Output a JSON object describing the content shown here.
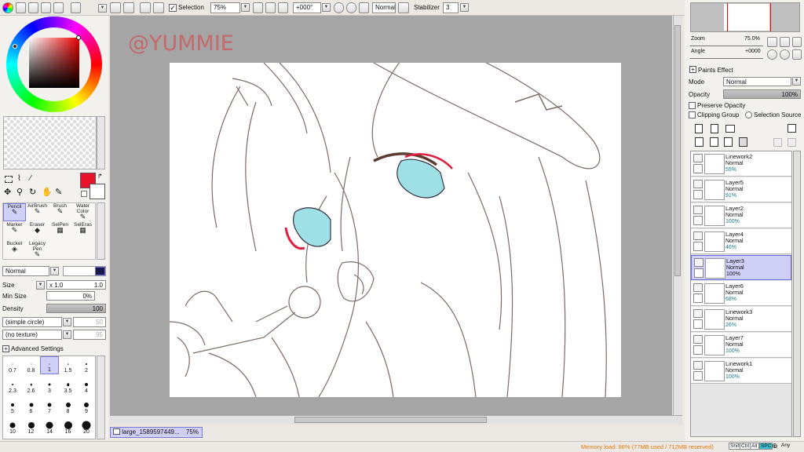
{
  "toolbar": {
    "selection_label": "Selection",
    "zoom": "75%",
    "angle": "+000°",
    "blend": "Normal",
    "stabilizer_label": "Stabilizer",
    "stabilizer": "3"
  },
  "canvas": {
    "watermark": "@YUMMIE",
    "tab_name": "large_1589597449...",
    "tab_zoom": "75%"
  },
  "navigator": {
    "zoom_label": "Zoom",
    "zoom_value": "75.0%",
    "angle_label": "Angle",
    "angle_value": "+0000"
  },
  "layer_panel": {
    "paints_effect": "Paints Effect",
    "mode_label": "Mode",
    "mode_value": "Normal",
    "opacity_label": "Opacity",
    "opacity_value": "100%",
    "preserve_opacity": "Preserve Opacity",
    "clipping_group": "Clipping Group",
    "selection_source": "Selection Source",
    "layers": [
      {
        "name": "Linework2",
        "mode": "Normal",
        "opacity": "55%"
      },
      {
        "name": "Layer5",
        "mode": "Normal",
        "opacity": "91%"
      },
      {
        "name": "Layer2",
        "mode": "Normal",
        "opacity": "100%"
      },
      {
        "name": "Layer4",
        "mode": "Normal",
        "opacity": "46%"
      },
      {
        "name": "Layer3",
        "mode": "Normal",
        "opacity": "100%"
      },
      {
        "name": "Layer6",
        "mode": "Normal",
        "opacity": "68%"
      },
      {
        "name": "Linework3",
        "mode": "Normal",
        "opacity": "26%"
      },
      {
        "name": "Layer7",
        "mode": "Normal",
        "opacity": "100%"
      },
      {
        "name": "Linework1",
        "mode": "Normal",
        "opacity": "100%"
      }
    ]
  },
  "tools": {
    "items": [
      "Pencil",
      "AirBrush",
      "Brush",
      "Water Color",
      "Marker",
      "Eraser",
      "SelPen",
      "SelEras",
      "Bucket",
      "Legacy Pen"
    ],
    "blend_mode": "Normal",
    "size_label": "Size",
    "size_mult": "x 1.0",
    "size_value": "1.0",
    "min_size_label": "Min Size",
    "min_size_value": "0%",
    "density_label": "Density",
    "density_value": "100",
    "shape": "(simple circle)",
    "shape_value": "50",
    "texture": "(no texture)",
    "texture_value": "95",
    "advanced": "Advanced Settings",
    "brush_sizes": [
      "0.7",
      "0.8",
      "1",
      "1.5",
      "2",
      "2.3",
      "2.6",
      "3",
      "3.5",
      "4",
      "5",
      "6",
      "7",
      "8",
      "9",
      "10",
      "12",
      "14",
      "16",
      "20"
    ]
  },
  "status": {
    "memory": "Memory load: 86% (77MB used / 712MB reserved)",
    "keys": [
      "Shift",
      "Ctrl",
      "Alt",
      "SPC",
      "Any"
    ]
  },
  "colors": {
    "primary": "#e8122a",
    "accent_sel": "#d0d0f6"
  }
}
